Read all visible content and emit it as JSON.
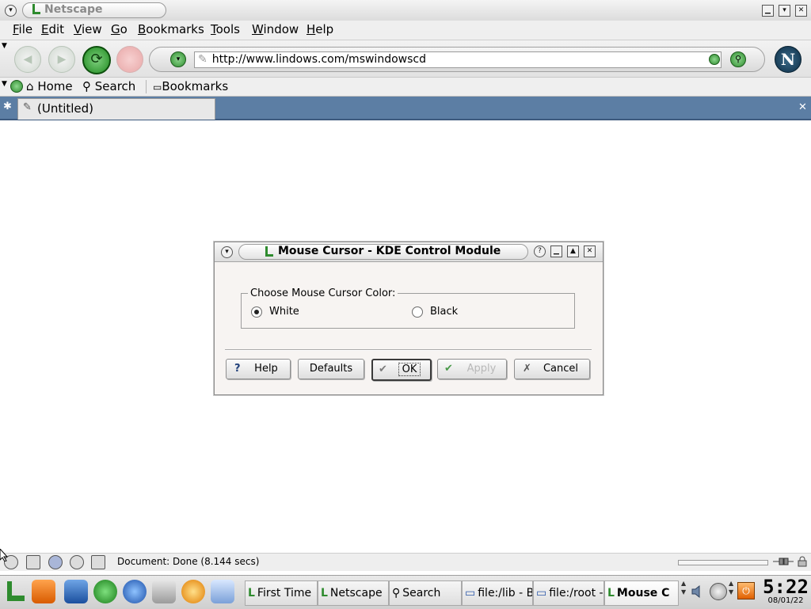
{
  "window": {
    "title": "Netscape"
  },
  "menubar": {
    "items": [
      "File",
      "Edit",
      "View",
      "Go",
      "Bookmarks",
      "Tools",
      "Window",
      "Help"
    ]
  },
  "navigation": {
    "url": "http://www.lindows.com/mswindowscd"
  },
  "personal_toolbar": {
    "home": "Home",
    "search": "Search",
    "bookmarks": "Bookmarks"
  },
  "tabs": [
    {
      "label": "(Untitled)"
    }
  ],
  "dialog": {
    "title": "Mouse Cursor - KDE Control Module",
    "group_label": "Choose Mouse Cursor Color:",
    "options": [
      {
        "label": "White",
        "selected": true
      },
      {
        "label": "Black",
        "selected": false
      }
    ],
    "buttons": {
      "help": "Help",
      "defaults": "Defaults",
      "ok": "OK",
      "apply": "Apply",
      "cancel": "Cancel"
    }
  },
  "status": {
    "text": "Document: Done (8.144 secs)"
  },
  "taskbar": {
    "tasks": [
      "First Time",
      "Netscape",
      "Search",
      "file:/lib - B",
      "file:/root -",
      "Mouse C"
    ],
    "clock_time": "5:22",
    "clock_date": "08/01/22"
  },
  "colors": {
    "tab_bar": "#5c7ea4",
    "dialog_bg": "#f7f4f2",
    "nav_green": "#2e8b2e"
  }
}
